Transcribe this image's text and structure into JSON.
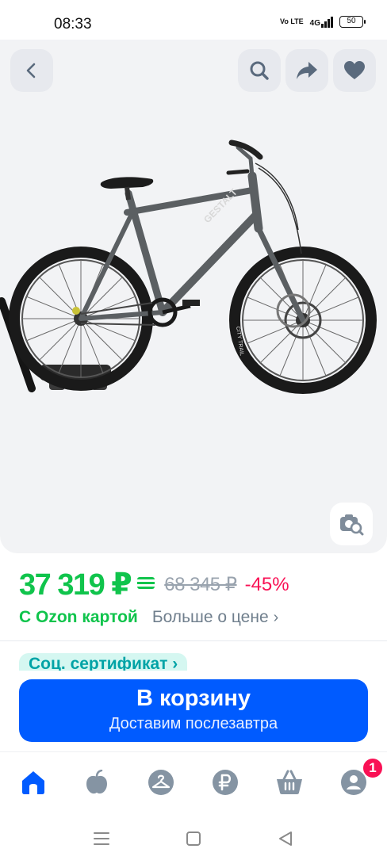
{
  "status_bar": {
    "time": "08:33",
    "volte": "Vo LTE",
    "network": "4G",
    "battery": "50"
  },
  "gallery": {
    "icons": [
      "back-arrow-icon",
      "search-icon",
      "share-icon",
      "heart-icon",
      "photo-search-icon"
    ],
    "image_subject": "GESTALT bicycle",
    "frame_text": "GESTALT",
    "tyre_text": "CITY TRAIL"
  },
  "price": {
    "current": "37 319 ₽",
    "old": "68 345 ₽",
    "discount": "-45%",
    "card_label": "С Ozon картой",
    "more_label": "Больше о цене",
    "more_chevron": "›"
  },
  "chip": {
    "label": "Соц. сертификат ›"
  },
  "cart_button": {
    "title": "В корзину",
    "subtitle": "Доставим послезавтра"
  },
  "tab_bar": {
    "items": [
      {
        "name": "home",
        "icon": "home-icon",
        "active": true
      },
      {
        "name": "fresh",
        "icon": "apple-icon",
        "active": false
      },
      {
        "name": "clothes",
        "icon": "hanger-icon",
        "active": false
      },
      {
        "name": "finance",
        "icon": "ruble-icon",
        "active": false
      },
      {
        "name": "cart",
        "icon": "basket-icon",
        "active": false
      },
      {
        "name": "profile",
        "icon": "profile-icon",
        "active": false
      }
    ],
    "profile_badge": "1"
  },
  "colors": {
    "accent_blue": "#005bff",
    "price_green": "#10c44c",
    "discount_pink": "#f91155",
    "icon_gray": "#707f8d"
  }
}
